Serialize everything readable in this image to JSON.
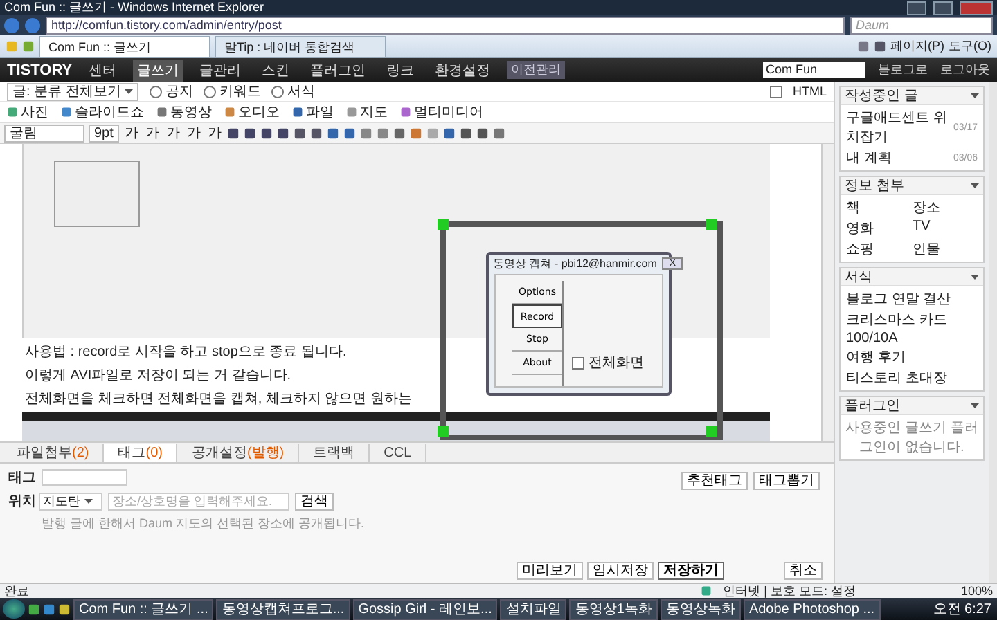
{
  "window": {
    "title": "Com Fun :: 글쓰기 - Windows Internet Explorer"
  },
  "address_bar": {
    "url": "http://comfun.tistory.com/admin/entry/post",
    "search_placeholder": "Daum"
  },
  "browser_tabs": [
    {
      "label": "Com Fun :: 글쓰기",
      "selected": true
    },
    {
      "label": "말Tip : 네이버 통합검색",
      "selected": false
    }
  ],
  "browser_tools": [
    "페이지(P)",
    "도구(O)"
  ],
  "blog_nav": {
    "logo": "TISTORY",
    "items": [
      {
        "label": "센터",
        "selected": false
      },
      {
        "label": "글쓰기",
        "selected": true
      },
      {
        "label": "글관리",
        "selected": false
      },
      {
        "label": "스킨",
        "selected": false
      },
      {
        "label": "플러그인",
        "selected": false
      },
      {
        "label": "링크",
        "selected": false
      },
      {
        "label": "환경설정",
        "selected": false
      }
    ],
    "migration": "이전관리",
    "blog_name": "Com Fun",
    "links": [
      "블로그로",
      "로그아웃"
    ]
  },
  "editor": {
    "category": "글: 분류 전체보기",
    "radios": [
      {
        "label": "공지",
        "selected": false
      },
      {
        "label": "키워드",
        "selected": false
      },
      {
        "label": "서식",
        "selected": false
      }
    ],
    "html_checkbox": {
      "label": "HTML",
      "checked": false
    },
    "media_buttons": [
      "사진",
      "슬라이드쇼",
      "동영상",
      "오디오",
      "파일",
      "지도",
      "멀티미디어"
    ],
    "font": "굴림",
    "size": "9pt",
    "format_letters": [
      "가",
      "가",
      "가",
      "가",
      "가"
    ],
    "content": {
      "lines": [
        "사용법 : record로 시작을 하고 stop으로 종료 됩니다.",
        "이렇게 AVI파일로 저장이 되는 거 같습니다.",
        "전체화면을 체크하면 전체화면을 캡쳐, 체크하지 않으면 원하는"
      ],
      "dialog": {
        "title": "동영상 캡쳐 - pbi12@hanmir.com",
        "close": "X",
        "buttons": [
          {
            "label": "Options",
            "selected": false
          },
          {
            "label": "Record",
            "selected": true
          },
          {
            "label": "Stop",
            "selected": false
          },
          {
            "label": "About",
            "selected": false
          }
        ],
        "checkbox": {
          "label": "전체화면",
          "checked": false
        }
      }
    }
  },
  "bottom_tabs": [
    {
      "label": "파일첨부",
      "count": "(2)",
      "selected": false
    },
    {
      "label": "태그",
      "count": "(0)",
      "selected": true
    },
    {
      "label": "공개설정",
      "count": "(발행)",
      "selected": false
    },
    {
      "label": "트랙백",
      "selected": false
    },
    {
      "label": "CCL",
      "selected": false
    }
  ],
  "tag_panel": {
    "tag_label": "태그",
    "location_label": "위치",
    "map_select": "지도탄",
    "location_placeholder": "장소/상호명을 입력해주세요.",
    "search_button": "검색",
    "note": "발행 글에 한해서 Daum 지도의 선택된 장소에 공개됩니다.",
    "tag_buttons": [
      "추천태그",
      "태그뽑기"
    ]
  },
  "actions": [
    {
      "label": "미리보기",
      "primary": false
    },
    {
      "label": "임시저장",
      "primary": false
    },
    {
      "label": "저장하기",
      "primary": true
    }
  ],
  "cancel": "취소",
  "sidebar": {
    "panels": [
      {
        "title": "작성중인 글",
        "kind": "drafts",
        "items": [
          {
            "label": "구글애드센트 위치잡기",
            "date": "03/17"
          },
          {
            "label": "내 계획",
            "date": "03/06"
          }
        ]
      },
      {
        "title": "정보 첨부",
        "kind": "grid",
        "items": [
          "책",
          "장소",
          "영화",
          "TV",
          "쇼핑",
          "인물"
        ]
      },
      {
        "title": "서식",
        "kind": "list",
        "items": [
          "블로그 연말 결산",
          "크리스마스 카드",
          "100/10A",
          "여행 후기",
          "티스토리 초대장"
        ]
      },
      {
        "title": "플러그인",
        "kind": "message",
        "message": "사용중인 글쓰기 플러그인이 없습니다."
      }
    ]
  },
  "status_bar": {
    "text": "완료",
    "zone": "인터넷 | 보호 모드: 설정",
    "zoom": "100%"
  },
  "taskbar": {
    "items": [
      "Com Fun :: 글쓰기 ...",
      "동영상캡쳐프로그...",
      "Gossip Girl - 레인보...",
      "설치파일",
      "동영상1녹화",
      "동영상녹화",
      "Adobe Photoshop ..."
    ],
    "clock": "오전 6:27"
  }
}
